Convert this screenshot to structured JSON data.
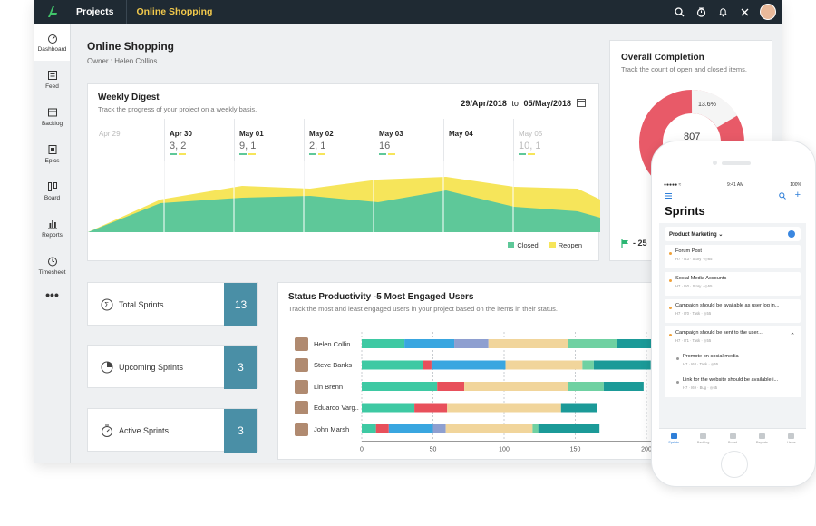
{
  "topbar": {
    "projects_label": "Projects",
    "current_project": "Online Shopping"
  },
  "sidebar": {
    "items": [
      {
        "label": "Dashboard",
        "icon": "dashboard-icon",
        "active": true
      },
      {
        "label": "Feed",
        "icon": "feed-icon"
      },
      {
        "label": "Backlog",
        "icon": "backlog-icon"
      },
      {
        "label": "Epics",
        "icon": "epics-icon"
      },
      {
        "label": "Board",
        "icon": "board-icon"
      },
      {
        "label": "Reports",
        "icon": "reports-icon"
      },
      {
        "label": "Timesheet",
        "icon": "timesheet-icon"
      }
    ],
    "more_label": "•••"
  },
  "header": {
    "title": "Online Shopping",
    "owner_label": "Owner :",
    "owner_name": "Helen Collins"
  },
  "weekly_digest": {
    "title": "Weekly Digest",
    "subtitle": "Track the progress of your project on a weekly basis.",
    "range_start": "29/Apr/2018",
    "range_to": "to",
    "range_end": "05/May/2018",
    "days": [
      {
        "name": "Apr 29",
        "value": "",
        "dim": true
      },
      {
        "name": "Apr 30",
        "value": "3, 2"
      },
      {
        "name": "May 01",
        "value": "9, 1"
      },
      {
        "name": "May 02",
        "value": "2, 1"
      },
      {
        "name": "May 03",
        "value": "16"
      },
      {
        "name": "May 04",
        "value": ""
      },
      {
        "name": "May 05",
        "value": "10, 1",
        "dim": true
      }
    ],
    "legend_closed": "Closed",
    "legend_reopen": "Reopen",
    "colors": {
      "closed": "#5ec899",
      "reopen": "#f6e55a"
    }
  },
  "overall": {
    "title": "Overall Completion",
    "subtitle": "Track the count of open and closed items.",
    "percent_label": "13.6%",
    "total": "807",
    "flag_value": "- 25",
    "colors": {
      "main": "#e85a68",
      "light": "#f5f5f5"
    }
  },
  "stats": {
    "total_sprints_label": "Total Sprints",
    "total_sprints_value": "13",
    "upcoming_sprints_label": "Upcoming Sprints",
    "upcoming_sprints_value": "3",
    "active_sprints_label": "Active Sprints",
    "active_sprints_value": "3"
  },
  "status_productivity": {
    "title": "Status Productivity -5 Most Engaged Users",
    "subtitle": "Track the most and least engaged users in your project based on the items in their status.",
    "users": [
      "Helen Collin...",
      "Steve Banks",
      "Lin Brenn",
      "Eduardo Varg...",
      "John Marsh"
    ]
  },
  "chart_data": {
    "type": "bar",
    "orientation": "horizontal",
    "stacked": true,
    "categories": [
      "Helen Collin...",
      "Steve Banks",
      "Lin Brenn",
      "Eduardo Varg...",
      "John Marsh"
    ],
    "x_ticks": [
      0,
      50,
      100,
      150,
      200
    ],
    "xlim": [
      0,
      200
    ],
    "grid": true,
    "segment_colors": [
      "#3ec9a3",
      "#e8505b",
      "#39a6e0",
      "#8e9fd0",
      "#f1d59b",
      "#6fd1a2",
      "#1b9a98"
    ],
    "rows": [
      [
        30,
        0,
        35,
        24,
        56,
        34,
        25
      ],
      [
        43,
        6,
        52,
        0,
        54,
        8,
        40
      ],
      [
        53,
        19,
        0,
        0,
        73,
        25,
        28
      ],
      [
        37,
        23,
        0,
        0,
        80,
        0,
        25
      ],
      [
        10,
        9,
        31,
        9,
        61,
        4,
        43
      ]
    ]
  },
  "phone": {
    "status_left": "●●●●● ≈",
    "status_time": "9:41 AM",
    "status_right": "100%",
    "title": "Sprints",
    "dropdown": "Product Marketing ⌄",
    "items": [
      {
        "title": "Forum Post",
        "meta": "H7 · I43 · Story · ◎65",
        "color": "orange"
      },
      {
        "title": "Social Media Accounts",
        "meta": "H7 · I50 · Story · ◎55",
        "color": "orange"
      },
      {
        "title": "Campaign should be available as user log in...",
        "meta": "H7 · I70 · Task · ◎55",
        "color": "orange"
      },
      {
        "title": "Campaign should be sent to the user...",
        "meta": "H7 · I71 · Task · ◎55",
        "color": "orange"
      },
      {
        "title": "Promote on social media",
        "meta": "H7 · I68 · Task · ◎55",
        "color": "grey"
      },
      {
        "title": "Link for the website should be available i...",
        "meta": "H7 · I69 · Bug · ◎65",
        "color": "grey"
      }
    ],
    "tabs": [
      "Sprints",
      "Backlog",
      "Board",
      "Reports",
      "Users"
    ]
  }
}
